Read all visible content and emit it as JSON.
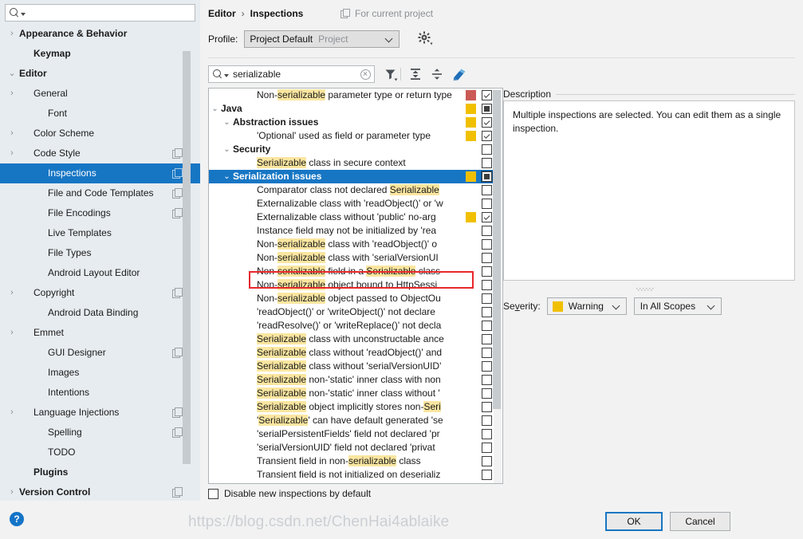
{
  "sidebar": {
    "search_placeholder": "",
    "search_value": "",
    "items": [
      {
        "label": "Appearance & Behavior",
        "twisty": "›",
        "bold": true,
        "indent": 0,
        "copy": false,
        "selected": false
      },
      {
        "label": "Keymap",
        "twisty": "",
        "bold": true,
        "indent": 1,
        "copy": false,
        "selected": false
      },
      {
        "label": "Editor",
        "twisty": "⌄",
        "bold": true,
        "indent": 0,
        "copy": false,
        "selected": false
      },
      {
        "label": "General",
        "twisty": "›",
        "bold": false,
        "indent": 1,
        "copy": false,
        "selected": false
      },
      {
        "label": "Font",
        "twisty": "",
        "bold": false,
        "indent": 2,
        "copy": false,
        "selected": false
      },
      {
        "label": "Color Scheme",
        "twisty": "›",
        "bold": false,
        "indent": 1,
        "copy": false,
        "selected": false
      },
      {
        "label": "Code Style",
        "twisty": "›",
        "bold": false,
        "indent": 1,
        "copy": true,
        "selected": false
      },
      {
        "label": "Inspections",
        "twisty": "",
        "bold": false,
        "indent": 2,
        "copy": true,
        "selected": true
      },
      {
        "label": "File and Code Templates",
        "twisty": "",
        "bold": false,
        "indent": 2,
        "copy": true,
        "selected": false
      },
      {
        "label": "File Encodings",
        "twisty": "",
        "bold": false,
        "indent": 2,
        "copy": true,
        "selected": false
      },
      {
        "label": "Live Templates",
        "twisty": "",
        "bold": false,
        "indent": 2,
        "copy": false,
        "selected": false
      },
      {
        "label": "File Types",
        "twisty": "",
        "bold": false,
        "indent": 2,
        "copy": false,
        "selected": false
      },
      {
        "label": "Android Layout Editor",
        "twisty": "",
        "bold": false,
        "indent": 2,
        "copy": false,
        "selected": false
      },
      {
        "label": "Copyright",
        "twisty": "›",
        "bold": false,
        "indent": 1,
        "copy": true,
        "selected": false
      },
      {
        "label": "Android Data Binding",
        "twisty": "",
        "bold": false,
        "indent": 2,
        "copy": false,
        "selected": false
      },
      {
        "label": "Emmet",
        "twisty": "›",
        "bold": false,
        "indent": 1,
        "copy": false,
        "selected": false
      },
      {
        "label": "GUI Designer",
        "twisty": "",
        "bold": false,
        "indent": 2,
        "copy": true,
        "selected": false
      },
      {
        "label": "Images",
        "twisty": "",
        "bold": false,
        "indent": 2,
        "copy": false,
        "selected": false
      },
      {
        "label": "Intentions",
        "twisty": "",
        "bold": false,
        "indent": 2,
        "copy": false,
        "selected": false
      },
      {
        "label": "Language Injections",
        "twisty": "›",
        "bold": false,
        "indent": 1,
        "copy": true,
        "selected": false
      },
      {
        "label": "Spelling",
        "twisty": "",
        "bold": false,
        "indent": 2,
        "copy": true,
        "selected": false
      },
      {
        "label": "TODO",
        "twisty": "",
        "bold": false,
        "indent": 2,
        "copy": false,
        "selected": false
      },
      {
        "label": "Plugins",
        "twisty": "",
        "bold": true,
        "indent": 1,
        "copy": false,
        "selected": false
      },
      {
        "label": "Version Control",
        "twisty": "›",
        "bold": true,
        "indent": 0,
        "copy": true,
        "selected": false
      }
    ],
    "help_glyph": "?"
  },
  "header": {
    "breadcrumb_root": "Editor",
    "breadcrumb_sep": "›",
    "breadcrumb_current": "Inspections",
    "for_current_project": "For current project",
    "profile_label": "Profile:",
    "profile_name": "Project Default",
    "profile_scope": "Project"
  },
  "toolbar": {
    "search_value": "serializable",
    "search_placeholder": "",
    "filter_icon": "filter-icon",
    "expand_icon": "expand-all-icon",
    "collapse_icon": "collapse-all-icon",
    "reset_icon": "reset-icon"
  },
  "colors": {
    "severity_error": "#CB5A56",
    "severity_warning": "#F0C000",
    "selection": "#1776C4",
    "highlight": "#FAE6A0",
    "redbox": "#E8282B"
  },
  "tree": {
    "rows": [
      {
        "indent": 3,
        "twisty": "",
        "bold": false,
        "check": "on",
        "sev": "#CB5A56",
        "selected": false,
        "parts": [
          {
            "t": "Non-",
            "h": false
          },
          {
            "t": "serializable",
            "h": true
          },
          {
            "t": " parameter type or return type",
            "h": false
          }
        ]
      },
      {
        "indent": 0,
        "twisty": "⌄",
        "bold": true,
        "check": "part",
        "sev": "#F0C000",
        "selected": false,
        "parts": [
          {
            "t": "Java",
            "h": false
          }
        ]
      },
      {
        "indent": 1,
        "twisty": "⌄",
        "bold": true,
        "check": "on",
        "sev": "#F0C000",
        "selected": false,
        "parts": [
          {
            "t": "Abstraction issues",
            "h": false
          }
        ]
      },
      {
        "indent": 3,
        "twisty": "",
        "bold": false,
        "check": "on",
        "sev": "#F0C000",
        "selected": false,
        "parts": [
          {
            "t": "'Optional' used as field or parameter type",
            "h": false
          }
        ]
      },
      {
        "indent": 1,
        "twisty": "⌄",
        "bold": true,
        "check": "off",
        "sev": "",
        "selected": false,
        "parts": [
          {
            "t": "Security",
            "h": false
          }
        ]
      },
      {
        "indent": 3,
        "twisty": "",
        "bold": false,
        "check": "off",
        "sev": "",
        "selected": false,
        "parts": [
          {
            "t": "Serializable",
            "h": true
          },
          {
            "t": " class in secure context",
            "h": false
          }
        ]
      },
      {
        "indent": 1,
        "twisty": "⌄",
        "bold": true,
        "check": "part",
        "sev": "#F0C000",
        "selected": true,
        "parts": [
          {
            "t": "Serialization issues",
            "h": false
          }
        ]
      },
      {
        "indent": 3,
        "twisty": "",
        "bold": false,
        "check": "off",
        "sev": "",
        "selected": false,
        "parts": [
          {
            "t": "Comparator class not declared ",
            "h": false
          },
          {
            "t": "Serializable",
            "h": true
          }
        ]
      },
      {
        "indent": 3,
        "twisty": "",
        "bold": false,
        "check": "off",
        "sev": "",
        "selected": false,
        "parts": [
          {
            "t": "Externalizable class with 'readObject()' or 'w",
            "h": false
          }
        ]
      },
      {
        "indent": 3,
        "twisty": "",
        "bold": false,
        "check": "on",
        "sev": "#F0C000",
        "selected": false,
        "parts": [
          {
            "t": "Externalizable class without 'public' no-arg ",
            "h": false
          }
        ]
      },
      {
        "indent": 3,
        "twisty": "",
        "bold": false,
        "check": "off",
        "sev": "",
        "selected": false,
        "parts": [
          {
            "t": "Instance field may not be initialized by 'rea",
            "h": false
          }
        ]
      },
      {
        "indent": 3,
        "twisty": "",
        "bold": false,
        "check": "off",
        "sev": "",
        "selected": false,
        "parts": [
          {
            "t": "Non-",
            "h": false
          },
          {
            "t": "serializable",
            "h": true
          },
          {
            "t": " class with 'readObject()' o",
            "h": false
          }
        ]
      },
      {
        "indent": 3,
        "twisty": "",
        "bold": false,
        "check": "off",
        "sev": "",
        "selected": false,
        "parts": [
          {
            "t": "Non-",
            "h": false
          },
          {
            "t": "serializable",
            "h": true
          },
          {
            "t": " class with 'serialVersionUI",
            "h": false
          }
        ]
      },
      {
        "indent": 3,
        "twisty": "",
        "bold": false,
        "check": "off",
        "sev": "",
        "selected": false,
        "parts": [
          {
            "t": "Non-",
            "h": false
          },
          {
            "t": "serializable",
            "h": true
          },
          {
            "t": " field in a ",
            "h": false
          },
          {
            "t": "Serializable",
            "h": true
          },
          {
            "t": " class",
            "h": false
          }
        ]
      },
      {
        "indent": 3,
        "twisty": "",
        "bold": false,
        "check": "off",
        "sev": "",
        "selected": false,
        "parts": [
          {
            "t": "Non-",
            "h": false
          },
          {
            "t": "serializable",
            "h": true
          },
          {
            "t": " object bound to HttpSessi",
            "h": false
          }
        ]
      },
      {
        "indent": 3,
        "twisty": "",
        "bold": false,
        "check": "off",
        "sev": "",
        "selected": false,
        "parts": [
          {
            "t": "Non-",
            "h": false
          },
          {
            "t": "serializable",
            "h": true
          },
          {
            "t": " object passed to ObjectOu",
            "h": false
          }
        ]
      },
      {
        "indent": 3,
        "twisty": "",
        "bold": false,
        "check": "off",
        "sev": "",
        "selected": false,
        "parts": [
          {
            "t": "'readObject()' or 'writeObject()' not declare",
            "h": false
          }
        ]
      },
      {
        "indent": 3,
        "twisty": "",
        "bold": false,
        "check": "off",
        "sev": "",
        "selected": false,
        "parts": [
          {
            "t": "'readResolve()' or 'writeReplace()' not decla",
            "h": false
          }
        ]
      },
      {
        "indent": 3,
        "twisty": "",
        "bold": false,
        "check": "off",
        "sev": "",
        "selected": false,
        "parts": [
          {
            "t": "Serializable",
            "h": true
          },
          {
            "t": " class with unconstructable ance",
            "h": false
          }
        ]
      },
      {
        "indent": 3,
        "twisty": "",
        "bold": false,
        "check": "off",
        "sev": "",
        "selected": false,
        "parts": [
          {
            "t": "Serializable",
            "h": true
          },
          {
            "t": " class without 'readObject()' and",
            "h": false
          }
        ]
      },
      {
        "indent": 3,
        "twisty": "",
        "bold": false,
        "check": "off",
        "sev": "",
        "selected": false,
        "boxed": true,
        "parts": [
          {
            "t": "Serializable",
            "h": true
          },
          {
            "t": " class without 'serialVersionUID'",
            "h": false
          }
        ]
      },
      {
        "indent": 3,
        "twisty": "",
        "bold": false,
        "check": "off",
        "sev": "",
        "selected": false,
        "parts": [
          {
            "t": "Serializable",
            "h": true
          },
          {
            "t": " non-'static' inner class with non",
            "h": false
          }
        ]
      },
      {
        "indent": 3,
        "twisty": "",
        "bold": false,
        "check": "off",
        "sev": "",
        "selected": false,
        "parts": [
          {
            "t": "Serializable",
            "h": true
          },
          {
            "t": " non-'static' inner class without '",
            "h": false
          }
        ]
      },
      {
        "indent": 3,
        "twisty": "",
        "bold": false,
        "check": "off",
        "sev": "",
        "selected": false,
        "parts": [
          {
            "t": "Serializable",
            "h": true
          },
          {
            "t": " object implicitly stores non-",
            "h": false
          },
          {
            "t": "Seri",
            "h": true
          }
        ]
      },
      {
        "indent": 3,
        "twisty": "",
        "bold": false,
        "check": "off",
        "sev": "",
        "selected": false,
        "parts": [
          {
            "t": "'",
            "h": false
          },
          {
            "t": "Serializable",
            "h": true
          },
          {
            "t": "' can have default generated 'se",
            "h": false
          }
        ]
      },
      {
        "indent": 3,
        "twisty": "",
        "bold": false,
        "check": "off",
        "sev": "",
        "selected": false,
        "parts": [
          {
            "t": "'serialPersistentFields' field not declared 'pr",
            "h": false
          }
        ]
      },
      {
        "indent": 3,
        "twisty": "",
        "bold": false,
        "check": "off",
        "sev": "",
        "selected": false,
        "parts": [
          {
            "t": "'serialVersionUID' field not declared 'privat",
            "h": false
          }
        ]
      },
      {
        "indent": 3,
        "twisty": "",
        "bold": false,
        "check": "off",
        "sev": "",
        "selected": false,
        "parts": [
          {
            "t": "Transient field in non-",
            "h": false
          },
          {
            "t": "serializable",
            "h": true
          },
          {
            "t": " class",
            "h": false
          }
        ]
      },
      {
        "indent": 3,
        "twisty": "",
        "bold": false,
        "check": "off",
        "sev": "",
        "selected": false,
        "parts": [
          {
            "t": "Transient field is not initialized on deserializ",
            "h": false
          }
        ]
      }
    ],
    "disable_new_label": "Disable new inspections by default",
    "disable_new_checked": false
  },
  "description": {
    "title": "Description",
    "text": "Multiple inspections are selected. You can edit them as a single inspection."
  },
  "severity": {
    "label": "Severity:",
    "value": "Warning",
    "swatch": "#F0C000",
    "scope_value": "In All Scopes"
  },
  "footer": {
    "ok_label": "OK",
    "cancel_label": "Cancel",
    "watermark": "https://blog.csdn.net/ChenHai4ablaike"
  }
}
